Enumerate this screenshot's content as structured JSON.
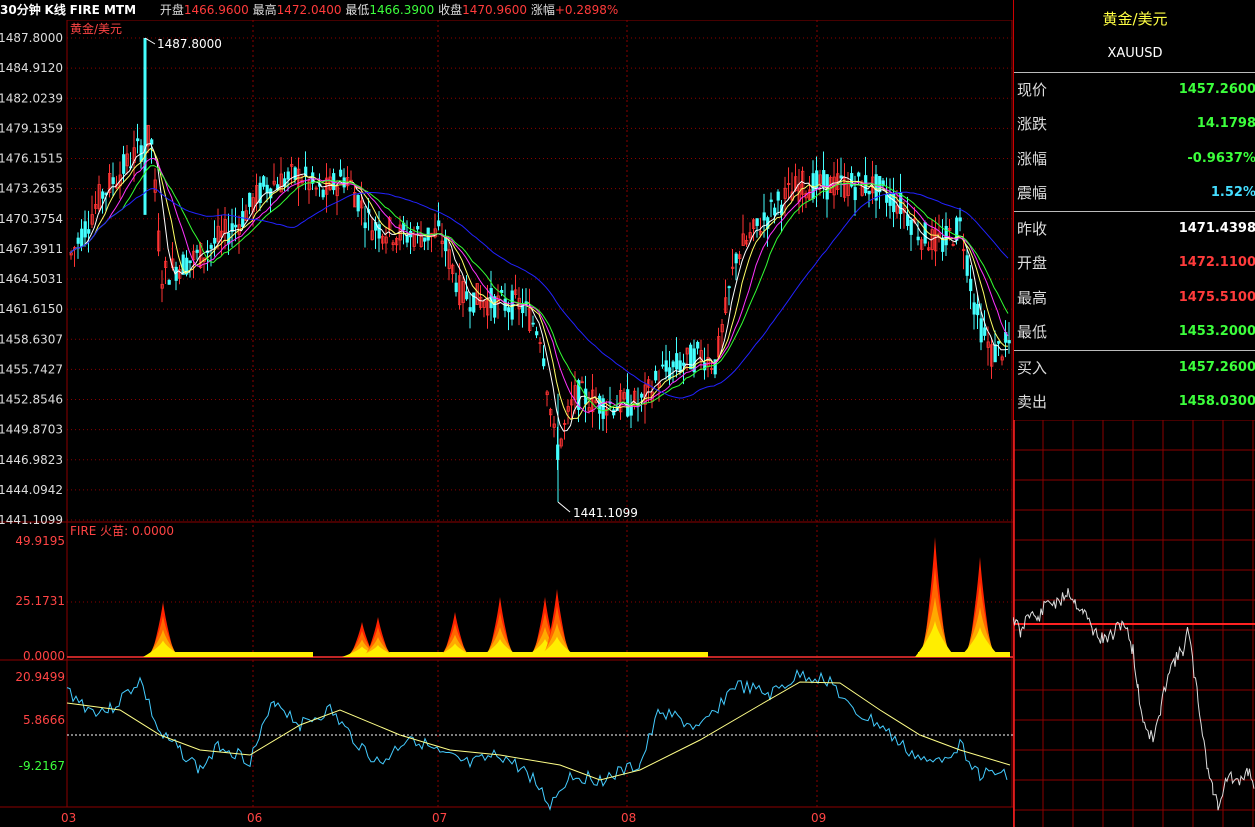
{
  "header": {
    "period": "30分钟",
    "kline": "K线",
    "indicators": "FIRE MTM",
    "open_label": "开盘",
    "open_value": "1466.9600",
    "high_label": "最高",
    "high_value": "1472.0400",
    "low_label": "最低",
    "low_value": "1466.3900",
    "close_label": "收盘",
    "close_value": "1470.9600",
    "change_label": "涨幅",
    "change_value": "+0.2898%"
  },
  "price_panel": {
    "name": "黄金/美元",
    "y_labels": [
      "1487.8000",
      "1484.9120",
      "1482.0239",
      "1479.1359",
      "1476.1515",
      "1473.2635",
      "1470.3754",
      "1467.3911",
      "1464.5031",
      "1461.6150",
      "1458.6307",
      "1455.7427",
      "1452.8546",
      "1449.8703",
      "1446.9823",
      "1444.0942",
      "1441.1099"
    ],
    "max_marker": "1487.8000",
    "min_marker": "1441.1099"
  },
  "fire_panel": {
    "title": "FIRE 火苗: 0.0000",
    "y_labels": [
      "49.9195",
      "25.1731",
      "0.0000"
    ]
  },
  "mtm_panel": {
    "y_labels": [
      "20.9499",
      "5.8666",
      "-9.2167"
    ]
  },
  "x_labels": [
    "03",
    "06",
    "07",
    "08",
    "09"
  ],
  "quote": {
    "title": "黄金/美元",
    "code": "XAUUSD",
    "rows": [
      {
        "label": "现价",
        "value": "1457.2600",
        "color": "#3cff3c"
      },
      {
        "label": "涨跌",
        "value": "14.1798",
        "color": "#3cff3c"
      },
      {
        "label": "涨幅",
        "value": "-0.9637%",
        "color": "#3cff3c"
      },
      {
        "label": "震幅",
        "value": "1.52%",
        "color": "#44ddff"
      },
      {
        "label": "昨收",
        "value": "1471.4398",
        "color": "#ffffff"
      },
      {
        "label": "开盘",
        "value": "1472.1100",
        "color": "#ff3b3b"
      },
      {
        "label": "最高",
        "value": "1475.5100",
        "color": "#ff3b3b"
      },
      {
        "label": "最低",
        "value": "1453.2000",
        "color": "#3cff3c"
      },
      {
        "label": "买入",
        "value": "1457.2600",
        "color": "#3cff3c"
      },
      {
        "label": "卖出",
        "value": "1458.0300",
        "color": "#3cff3c"
      }
    ]
  },
  "colors": {
    "up": "#ff3333",
    "down": "#44ffff",
    "grid": "#8b0000",
    "ma_white": "#ffffff",
    "ma_yellow": "#ffff66",
    "ma_pink": "#ff33ff",
    "ma_green": "#33ff33",
    "ma_blue": "#2222ff",
    "mtm": "#44ccff",
    "mtm_ma": "#ffff88"
  }
}
